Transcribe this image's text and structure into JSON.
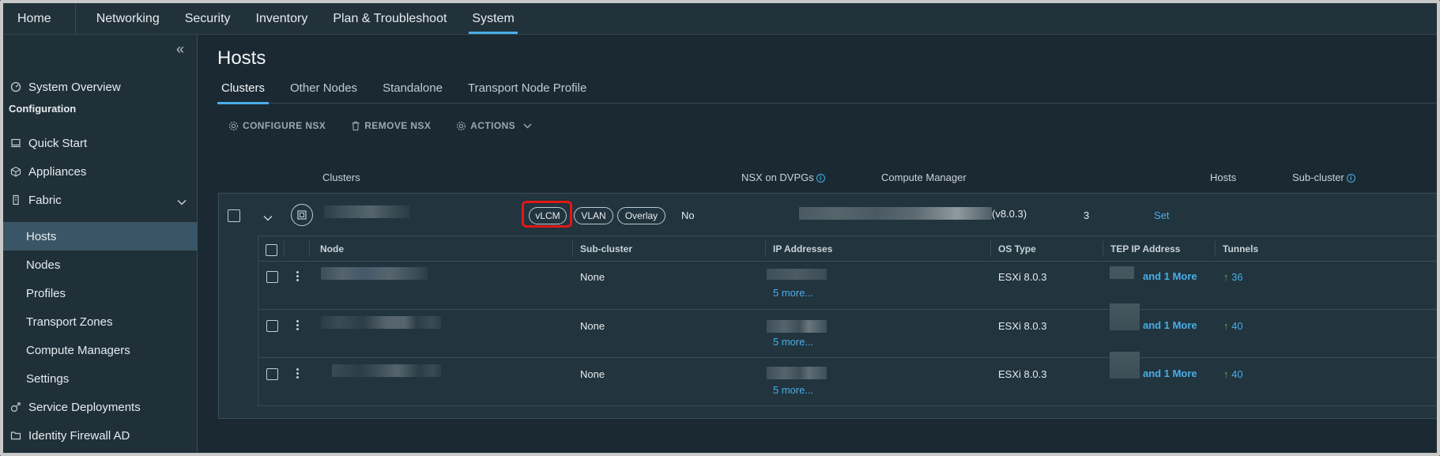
{
  "topnav": {
    "home": "Home",
    "items": [
      "Networking",
      "Security",
      "Inventory",
      "Plan & Troubleshoot",
      "System"
    ],
    "active": "System"
  },
  "sidebar": {
    "system_overview": "System Overview",
    "config_heading": "Configuration",
    "quick_start": "Quick Start",
    "appliances": "Appliances",
    "fabric": "Fabric",
    "fabric_items": [
      "Hosts",
      "Nodes",
      "Profiles",
      "Transport Zones",
      "Compute Managers",
      "Settings"
    ],
    "selected": "Hosts",
    "service_deployments": "Service Deployments",
    "identity_firewall": "Identity Firewall AD"
  },
  "page": {
    "title": "Hosts",
    "tabs": [
      "Clusters",
      "Other Nodes",
      "Standalone",
      "Transport Node Profile"
    ],
    "active_tab": "Clusters"
  },
  "toolbar": {
    "configure": "CONFIGURE NSX",
    "remove": "REMOVE NSX",
    "actions": "ACTIONS"
  },
  "grid": {
    "headers": {
      "clusters": "Clusters",
      "nsx_on_dvpgs": "NSX on DVPGs",
      "compute_manager": "Compute Manager",
      "hosts": "Hosts",
      "sub_cluster": "Sub-cluster"
    },
    "cluster": {
      "tags": [
        "vLCM",
        "VLAN",
        "Overlay"
      ],
      "highlighted_tag": "vLCM",
      "nsx_on_dvpgs": "No",
      "compute_manager_version": "(v8.0.3)",
      "hosts": "3",
      "sub_cluster": "Set"
    }
  },
  "node_table": {
    "headers": {
      "node": "Node",
      "sub_cluster": "Sub-cluster",
      "ip": "IP Addresses",
      "os": "OS Type",
      "tep": "TEP IP Address",
      "tunnels": "Tunnels"
    },
    "rows": [
      {
        "sub_cluster": "None",
        "ip_more": "5 more...",
        "os": "ESXi 8.0.3",
        "tep_more": "and 1 More",
        "tunnels": "36"
      },
      {
        "sub_cluster": "None",
        "ip_more": "5 more...",
        "os": "ESXi 8.0.3",
        "tep_more": "and 1 More",
        "tunnels": "40"
      },
      {
        "sub_cluster": "None",
        "ip_more": "5 more...",
        "os": "ESXi 8.0.3",
        "tep_more": "and 1 More",
        "tunnels": "40"
      }
    ]
  },
  "colors": {
    "accent": "#49aee8",
    "highlight": "#e01818",
    "tunnel_up": "#4fb35a"
  }
}
